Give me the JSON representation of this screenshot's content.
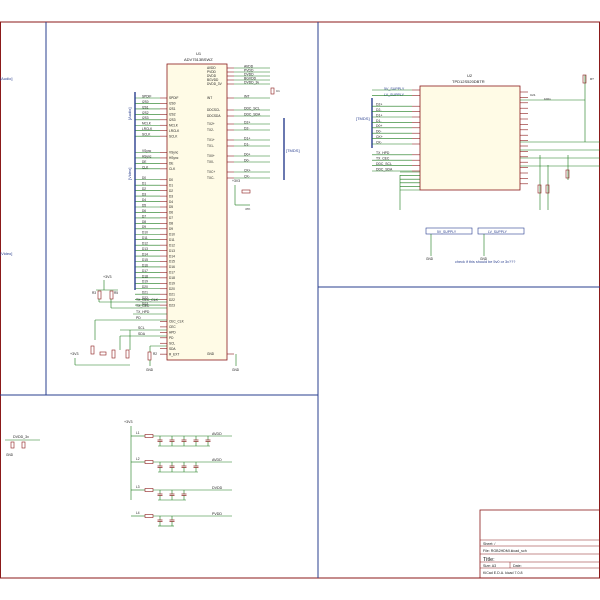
{
  "u1": {
    "ref": "U1",
    "part": "ADV7513BSWZ",
    "left_pins_top": [
      "SPDIF",
      "I2S0",
      "I2S1",
      "I2S2",
      "I2S3",
      "MCLK",
      "LRCLK",
      "SCLK"
    ],
    "left_pins_mid": [
      "VSync",
      "HSync",
      "DE",
      "CLK"
    ],
    "left_pins_d": [
      "D0",
      "D1",
      "D2",
      "D3",
      "D4",
      "D5",
      "D6",
      "D7",
      "D8",
      "D9",
      "D10",
      "D11",
      "D12",
      "D13",
      "D14",
      "D15",
      "D16",
      "D17",
      "D18",
      "D19",
      "D20",
      "D21",
      "D22",
      "D23"
    ],
    "left_pins_bot": [
      "CEC_CLK",
      "CEC",
      "HPD",
      "PD",
      "SCL",
      "SDA",
      "R_EXT"
    ],
    "right_pins": [
      "AVDD",
      "PVDD",
      "DVDD",
      "BGVDD",
      "DVDD_3V",
      "INT",
      "DDCSCL",
      "DDCSDA",
      "TX2+",
      "TX2-",
      "TX1+",
      "TX1-",
      "TX0+",
      "TX0-",
      "TXC+",
      "TXC-",
      "GND"
    ],
    "right_nets": [
      "AVDD",
      "PVDD",
      "DVDD",
      "BGVDD",
      "DVDD_3v",
      "INT",
      "DDC_SCL",
      "DDC_SDA",
      "D2+",
      "D2-",
      "D1+",
      "D1-",
      "D0+",
      "D0-",
      "CK+",
      "CK-"
    ],
    "bus_audio": "[Audio]",
    "bus_video": "[Video]",
    "bus_tmds": "[TMDS]",
    "i2s_nets": [
      "SPDIF",
      "I2S0",
      "I2S1",
      "I2S2",
      "I2S3",
      "MCLK",
      "LRCLK",
      "SCLK"
    ],
    "sync_nets": [
      "VSync",
      "HSync",
      "DE",
      "CLK"
    ],
    "ctrl_nets": [
      "TX_CEC_CLK",
      "TX_CEC",
      "TX_HPD",
      "PD",
      "SCL",
      "SDA"
    ],
    "r_labels": [
      "R3\n10K",
      "R5\n10K",
      "R4\n2K",
      "R1\n2K",
      "R2\n887R"
    ],
    "vcc": "+3V3",
    "gnd": "GND",
    "pd_r": "R?\n10K",
    "c1": "C1\n10u"
  },
  "u2": {
    "ref": "U2",
    "part": "TPD12S520DBTR",
    "supplies": [
      "5V_SUPPLY",
      "LV_SUPPLY"
    ],
    "left_tmds": [
      "D2+",
      "D2-",
      "D1+",
      "D1-",
      "D0+",
      "D0-",
      "CK+",
      "CK-"
    ],
    "left_ctrl": [
      "TX_HPD",
      "TX_CEC",
      "DDC_SCL",
      "DDC_SDA"
    ],
    "caption": "check if this should be 5v0 or 3v???",
    "c_labels": [
      "C20\n100n",
      "C21\n100n",
      "C22\n100n"
    ],
    "r_labels": [
      "R10\n27k",
      "R11\n27k",
      "R12\n27k"
    ],
    "sheet_left_labels": [
      "[Audio]",
      "[Video]"
    ],
    "sheet_tmds": "[TMDS]"
  },
  "power": {
    "vcc": "+3V3",
    "dvdd_label": "DVDD_3v",
    "rails": [
      "AVDD",
      "AVDD",
      "DVDD",
      "PVDD"
    ],
    "inductors": [
      "L1",
      "L2",
      "L3",
      "L4"
    ],
    "caps": [
      "C4\n10u",
      "C5\n100n",
      "C6\n100n",
      "C7\n100n",
      "C8\n100n",
      "C9\n10u",
      "C10\n100n",
      "C11\n100n",
      "C12\n100n",
      "C13\n10u",
      "C14\n100n",
      "C15\n10u",
      "C16\n100n"
    ]
  },
  "title_block": {
    "sheet": "Sheet: /",
    "file": "File: RGB2HDMI.kicad_sch",
    "title": "Title:",
    "size": "Size: A3",
    "date": "Date:",
    "kicad": "KiCad E.D.A.  kicad 7.0.8",
    "rev": "Rev:",
    "id": "Id: 1/1"
  },
  "colors": {
    "border": "#8b1a1a",
    "sheet": "#2a3f8f",
    "wire": "#1a7a1a",
    "part": "#8b1a1a",
    "fill": "#fffbe6",
    "text": "#1a1a1a"
  }
}
